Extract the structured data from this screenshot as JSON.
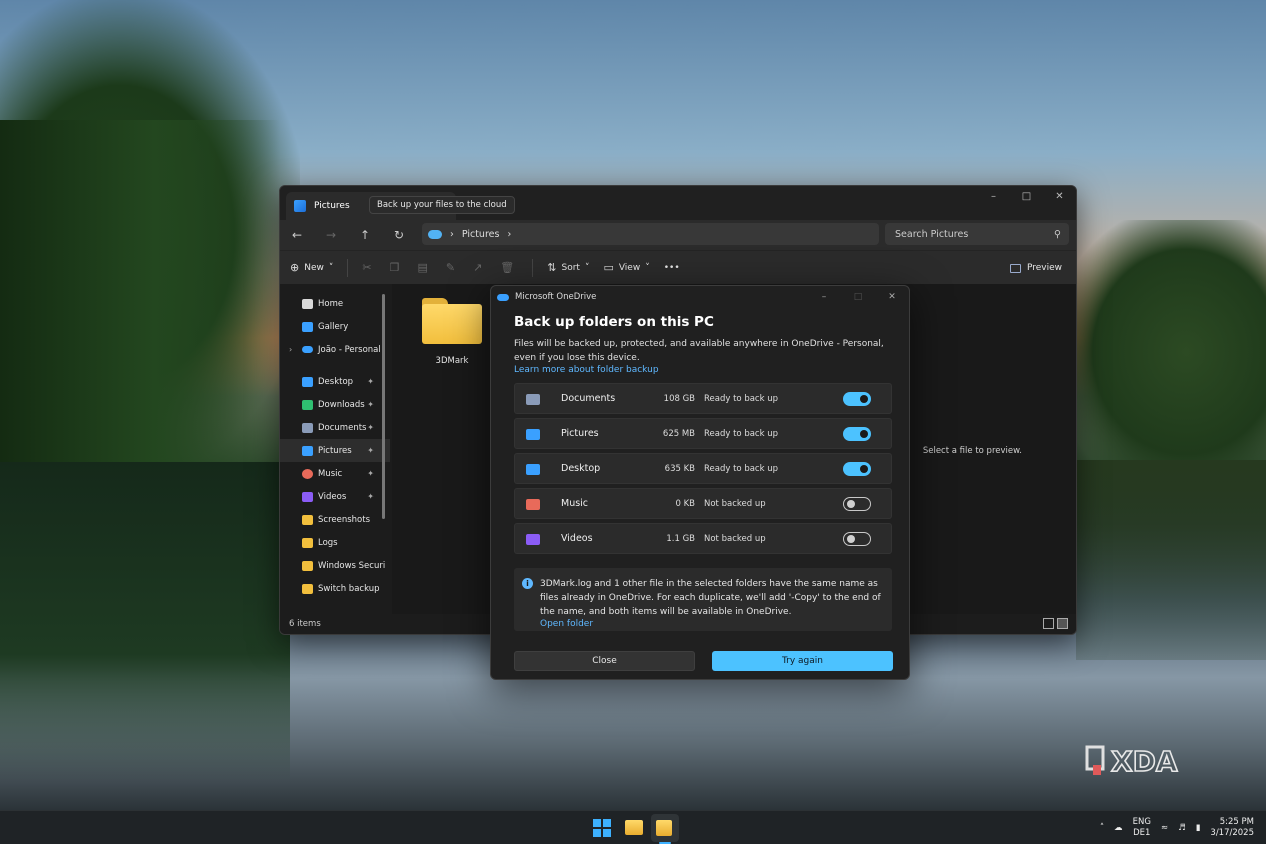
{
  "explorer": {
    "tab_title": "Pictures",
    "tooltip": "Back up your files to the cloud",
    "address_path": "Pictures",
    "search_placeholder": "Search Pictures",
    "toolbar": {
      "new_label": "New",
      "sort_label": "Sort",
      "view_label": "View",
      "more_label": "•••",
      "preview_label": "Preview"
    },
    "sidebar": {
      "items_top": [
        {
          "label": "Home",
          "color": "#d9d9d9"
        },
        {
          "label": "Gallery",
          "color": "#3aa0ff"
        },
        {
          "label": "João - Personal",
          "color": "#3aa0ff"
        }
      ],
      "items_pinned": [
        {
          "label": "Desktop",
          "color": "#3aa0ff",
          "pinned": true
        },
        {
          "label": "Downloads",
          "color": "#2fbf71",
          "pinned": true
        },
        {
          "label": "Documents",
          "color": "#8a9bb8",
          "pinned": true
        },
        {
          "label": "Pictures",
          "color": "#3aa0ff",
          "pinned": true,
          "selected": true
        },
        {
          "label": "Music",
          "color": "#e86a5a",
          "pinned": true
        },
        {
          "label": "Videos",
          "color": "#8b5cf6",
          "pinned": true
        },
        {
          "label": "Screenshots",
          "color": "#f2bf3d",
          "pinned": false
        },
        {
          "label": "Logs",
          "color": "#f2bf3d",
          "pinned": false
        },
        {
          "label": "Windows Securi",
          "color": "#f2bf3d",
          "pinned": false
        },
        {
          "label": "Switch backup",
          "color": "#f2bf3d",
          "pinned": false
        }
      ]
    },
    "files": [
      {
        "name": "3DMark"
      }
    ],
    "preview_message": "Select a file to preview.",
    "status": "6 items"
  },
  "onedrive": {
    "window_title": "Microsoft OneDrive",
    "heading": "Back up folders on this PC",
    "description": "Files will be backed up, protected, and available anywhere in OneDrive - Personal, even if you lose this device.",
    "learn_more": "Learn more about folder backup",
    "folders": [
      {
        "name": "Documents",
        "size": "108 GB",
        "status": "Ready to back up",
        "enabled": true,
        "color": "#8a9bb8"
      },
      {
        "name": "Pictures",
        "size": "625 MB",
        "status": "Ready to back up",
        "enabled": true,
        "color": "#3aa0ff"
      },
      {
        "name": "Desktop",
        "size": "635 KB",
        "status": "Ready to back up",
        "enabled": true,
        "color": "#3aa0ff"
      },
      {
        "name": "Music",
        "size": "0 KB",
        "status": "Not backed up",
        "enabled": false,
        "color": "#e86a5a"
      },
      {
        "name": "Videos",
        "size": "1.1 GB",
        "status": "Not backed up",
        "enabled": false,
        "color": "#8b5cf6"
      }
    ],
    "info_message": "3DMark.log and 1 other file in the selected folders have the same name as files already in OneDrive. For each duplicate, we'll add '-Copy' to the end of the name, and both items will be available in OneDrive.",
    "info_link": "Open folder",
    "close_label": "Close",
    "try_again_label": "Try again"
  },
  "watermark": "XDA",
  "taskbar": {
    "lang_top": "ENG",
    "lang_bottom": "DE1",
    "time": "5:25 PM",
    "date": "3/17/2025"
  }
}
